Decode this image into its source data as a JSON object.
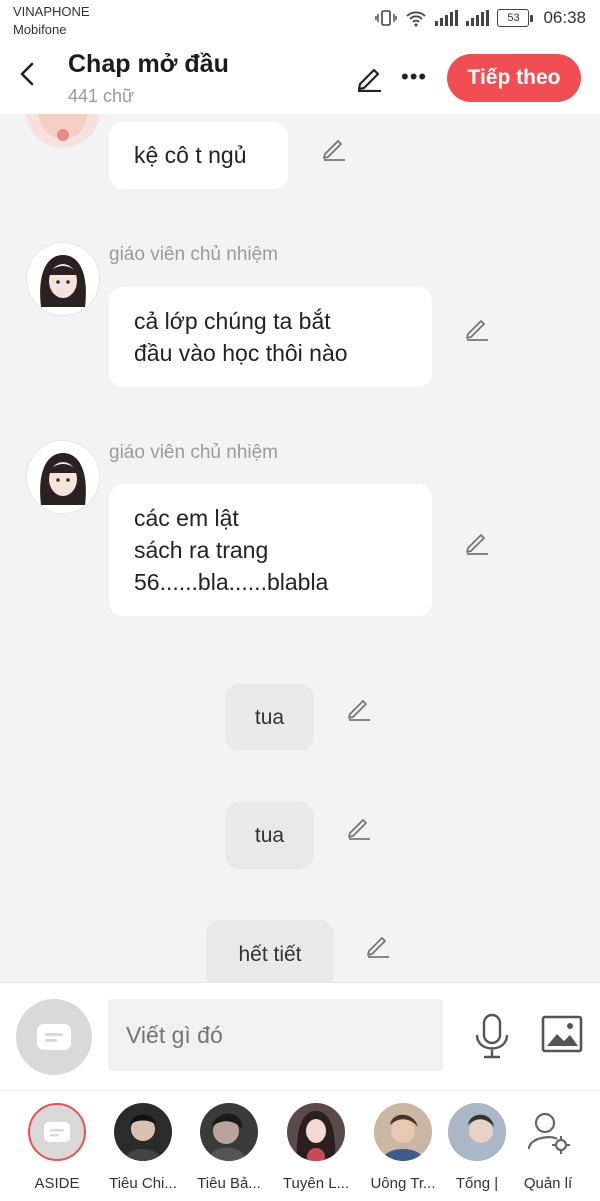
{
  "status": {
    "carrier1": "VINAPHONE",
    "carrier2": "Mobifone",
    "battery": "53",
    "time": "06:38"
  },
  "header": {
    "title": "Chap mở đầu",
    "subtitle": "441 chữ",
    "next_label": "Tiếp theo"
  },
  "messages": [
    {
      "text": "kệ cô t ngủ"
    },
    {
      "sender": "giáo viên chủ nhiệm",
      "lines": [
        "cả lớp chúng ta bắt",
        "đầu vào học thôi nào"
      ]
    },
    {
      "sender": "giáo viên chủ nhiệm",
      "lines": [
        "các em lật",
        "sách ra trang",
        "56......bla......blabla"
      ]
    }
  ],
  "narration": [
    "tua",
    "tua",
    "hết tiết"
  ],
  "composer": {
    "placeholder": "Viết gì đó"
  },
  "characters": [
    {
      "name": "ASIDE",
      "color": "#d9d9d9"
    },
    {
      "name": "Tiêu Chi...",
      "color": "#2b2b2b"
    },
    {
      "name": "Tiêu Bả...",
      "color": "#3a3a3a"
    },
    {
      "name": "Tuyên L...",
      "color": "#5a4a4a"
    },
    {
      "name": "Uông Tr...",
      "color": "#c9b7a3"
    },
    {
      "name": "Tống |",
      "color": "#a9b7c6"
    },
    {
      "name": "Quản lí",
      "color": "#ffffff"
    }
  ],
  "colors": {
    "accent": "#f04e52"
  }
}
